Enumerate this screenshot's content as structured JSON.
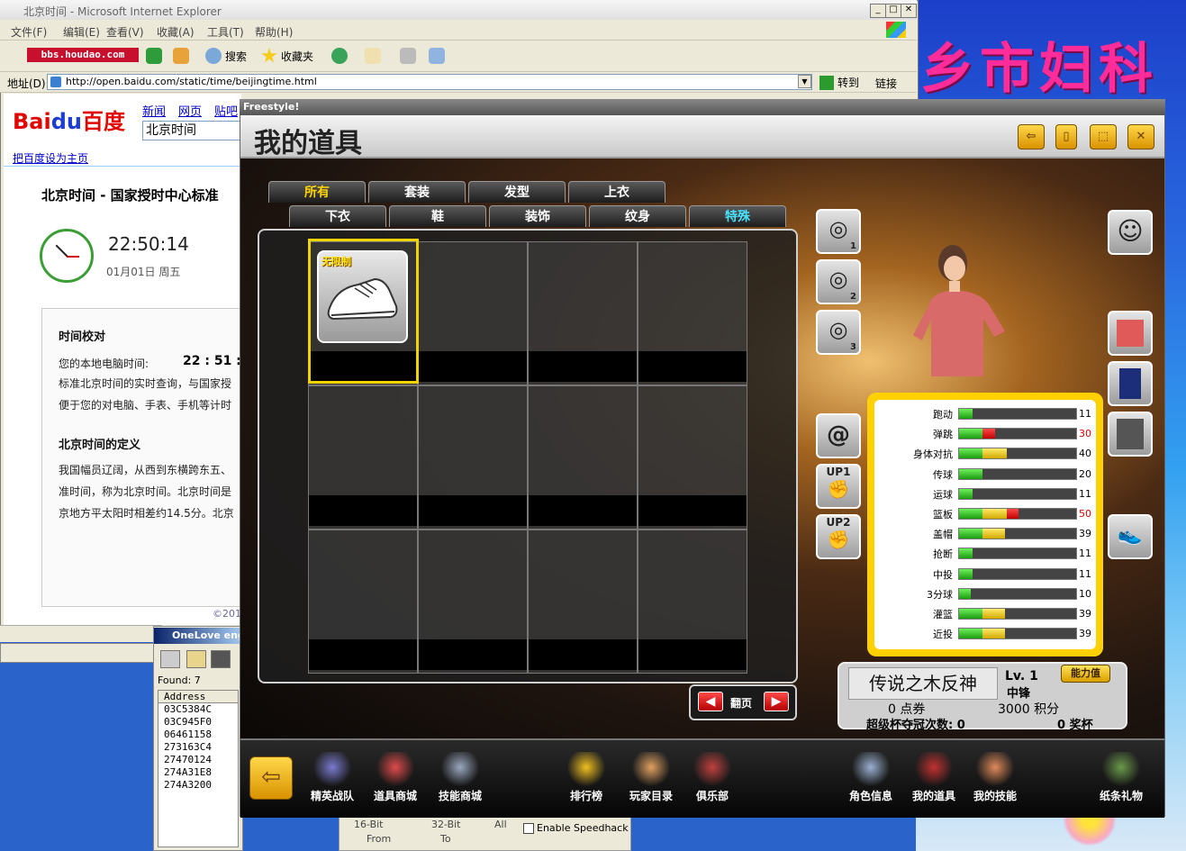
{
  "wallpaper": {
    "text": "乡市妇科"
  },
  "ie": {
    "title": "北京时间 - Microsoft Internet Explorer",
    "menu": [
      "文件(F)",
      "编辑(E)",
      "查看(V)",
      "收藏(A)",
      "工具(T)",
      "帮助(H)"
    ],
    "toolbar": {
      "search": "搜索",
      "favorites": "收藏夹"
    },
    "watermark": "bbs.houdao.com",
    "address_label": "地址(D)",
    "url": "http://open.baidu.com/static/time/beijingtime.html",
    "go": "转到",
    "links": "链接"
  },
  "baidu": {
    "tabs": [
      "新闻",
      "网页",
      "贴吧"
    ],
    "query": "北京时间",
    "set_home": "把百度设为主页",
    "page_title": "北京时间 - 国家授时中心标准",
    "clock_time": "22:50:14",
    "clock_date": "01月01日  周五",
    "section1_title": "时间校对",
    "local_time_label": "您的本地电脑时间:",
    "local_time_value": "22 : 51 :",
    "line2": "标准北京时间的实时查询，与国家授",
    "line3": "便于您的对电脑、手表、手机等计时",
    "section2_title": "北京时间的定义",
    "def1": "我国幅员辽阔，从西到东横跨东五、",
    "def2": "准时间，称为北京时间。北京时间是",
    "def3": "京地方平太阳时相差约14.5分。北京",
    "copyright": "©201"
  },
  "onelove": {
    "title": "OneLove eng",
    "found": "Found: 7",
    "col": "Address",
    "addresses": [
      "03C5384C",
      "03C945F0",
      "06461158",
      "273163C4",
      "27470124",
      "274A31E8",
      "274A3200"
    ]
  },
  "speedhack": {
    "bit16": "16-Bit",
    "bit32": "32-Bit",
    "all": "All",
    "from": "From",
    "to": "To",
    "enable": "Enable Speedhack"
  },
  "game": {
    "window_title": "Freestyle!",
    "header_title": "我的道具",
    "tabs_row1": [
      "所有",
      "套装",
      "发型",
      "上衣"
    ],
    "tabs_row2": [
      "下衣",
      "鞋",
      "装饰",
      "纹身",
      "特殊"
    ],
    "item_tag": "无限制",
    "pager_label": "翻页",
    "slots": [
      {
        "label": "1"
      },
      {
        "label": "2"
      },
      {
        "label": "3"
      }
    ],
    "up_buttons": [
      "UP1",
      "UP2"
    ],
    "stats": [
      {
        "label": "跑动",
        "value": "11",
        "green": 0.11,
        "yellow": 0,
        "red": 0
      },
      {
        "label": "弹跳",
        "value": "30",
        "green": 0.2,
        "yellow": 0,
        "red": 0.1
      },
      {
        "label": "身体对抗",
        "value": "40",
        "green": 0.2,
        "yellow": 0.2,
        "red": 0
      },
      {
        "label": "传球",
        "value": "20",
        "green": 0.2,
        "yellow": 0,
        "red": 0
      },
      {
        "label": "运球",
        "value": "11",
        "green": 0.11,
        "yellow": 0,
        "red": 0
      },
      {
        "label": "篮板",
        "value": "50",
        "green": 0.2,
        "yellow": 0.2,
        "red": 0.1
      },
      {
        "label": "盖帽",
        "value": "39",
        "green": 0.2,
        "yellow": 0.19,
        "red": 0
      },
      {
        "label": "抢断",
        "value": "11",
        "green": 0.11,
        "yellow": 0,
        "red": 0
      },
      {
        "label": "中投",
        "value": "11",
        "green": 0.11,
        "yellow": 0,
        "red": 0
      },
      {
        "label": "3分球",
        "value": "10",
        "green": 0.1,
        "yellow": 0,
        "red": 0
      },
      {
        "label": "灌篮",
        "value": "39",
        "green": 0.2,
        "yellow": 0.19,
        "red": 0
      },
      {
        "label": "近投",
        "value": "39",
        "green": 0.2,
        "yellow": 0.19,
        "red": 0
      }
    ],
    "player_name": "传说之木反神",
    "level": "Lv. 1",
    "position": "中锋",
    "ability_button": "能力值",
    "points": "0 点券",
    "score": "3000 积分",
    "super_cup": "超级杯夺冠次数: 0",
    "trophy": "0 奖杯",
    "bottom_nav": [
      "精英战队",
      "道具商城",
      "技能商城",
      "排行榜",
      "玩家目录",
      "俱乐部",
      "角色信息",
      "我的道具",
      "我的技能",
      "纸条礼物"
    ],
    "colors": {
      "accent": "#ffd100",
      "active_tab": "#ffd400",
      "special_tab": "#47e3ff"
    }
  }
}
